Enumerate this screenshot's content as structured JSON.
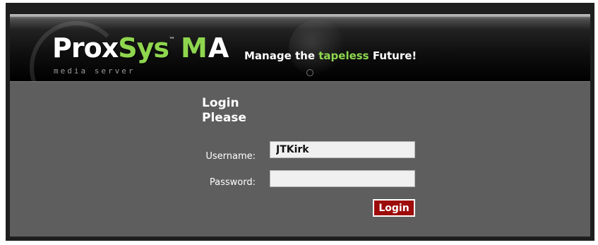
{
  "header": {
    "logo_prox": "Prox",
    "logo_sys": "Sys",
    "logo_tm": "™",
    "logo_ma_m": "M",
    "logo_ma_a": "A",
    "logo_sub": "media server",
    "tagline_pre": "Manage the ",
    "tagline_hl": "tapeless",
    "tagline_post": " Future!"
  },
  "login": {
    "title_line1": "Login",
    "title_line2": "Please",
    "username_label": "Username:",
    "username_value": "JTKirk",
    "password_label": "Password:",
    "password_value": "",
    "submit_label": "Login"
  },
  "colors": {
    "accent_green": "#8fd64f",
    "button_red": "#9d0b0b",
    "panel_gray": "#5e5e5e",
    "frame_dark": "#1e1e1e"
  }
}
